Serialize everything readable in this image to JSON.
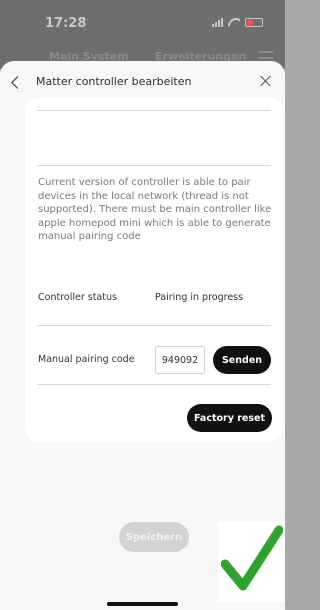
{
  "status_bar": {
    "time": "17:28"
  },
  "background_tabs": [
    "Mein System",
    "Erweiterungen"
  ],
  "header": {
    "title": "Matter controller bearbeiten"
  },
  "card": {
    "description": "Current version of controller is able to pair devices in the local network (thread is not supported). There must be main controller like apple homepod mini which is able to generate manual pairing code",
    "controller_status_label": "Controller status",
    "controller_status_value": "Pairing in progress",
    "pairing_code_label": "Manual pairing code",
    "pairing_code_value": "949092",
    "send_label": "Senden",
    "factory_reset_label": "Factory reset"
  },
  "save_label": "Speichern",
  "icons": {
    "status": [
      "signal-icon",
      "wifi-icon",
      "battery-icon"
    ],
    "header": [
      "back-icon",
      "close-icon"
    ],
    "overlay": "checkmark-icon"
  },
  "colors": {
    "primary_button": "#111111",
    "checkmark": "#2ea32e",
    "save_disabled": "#d3d3d3"
  }
}
